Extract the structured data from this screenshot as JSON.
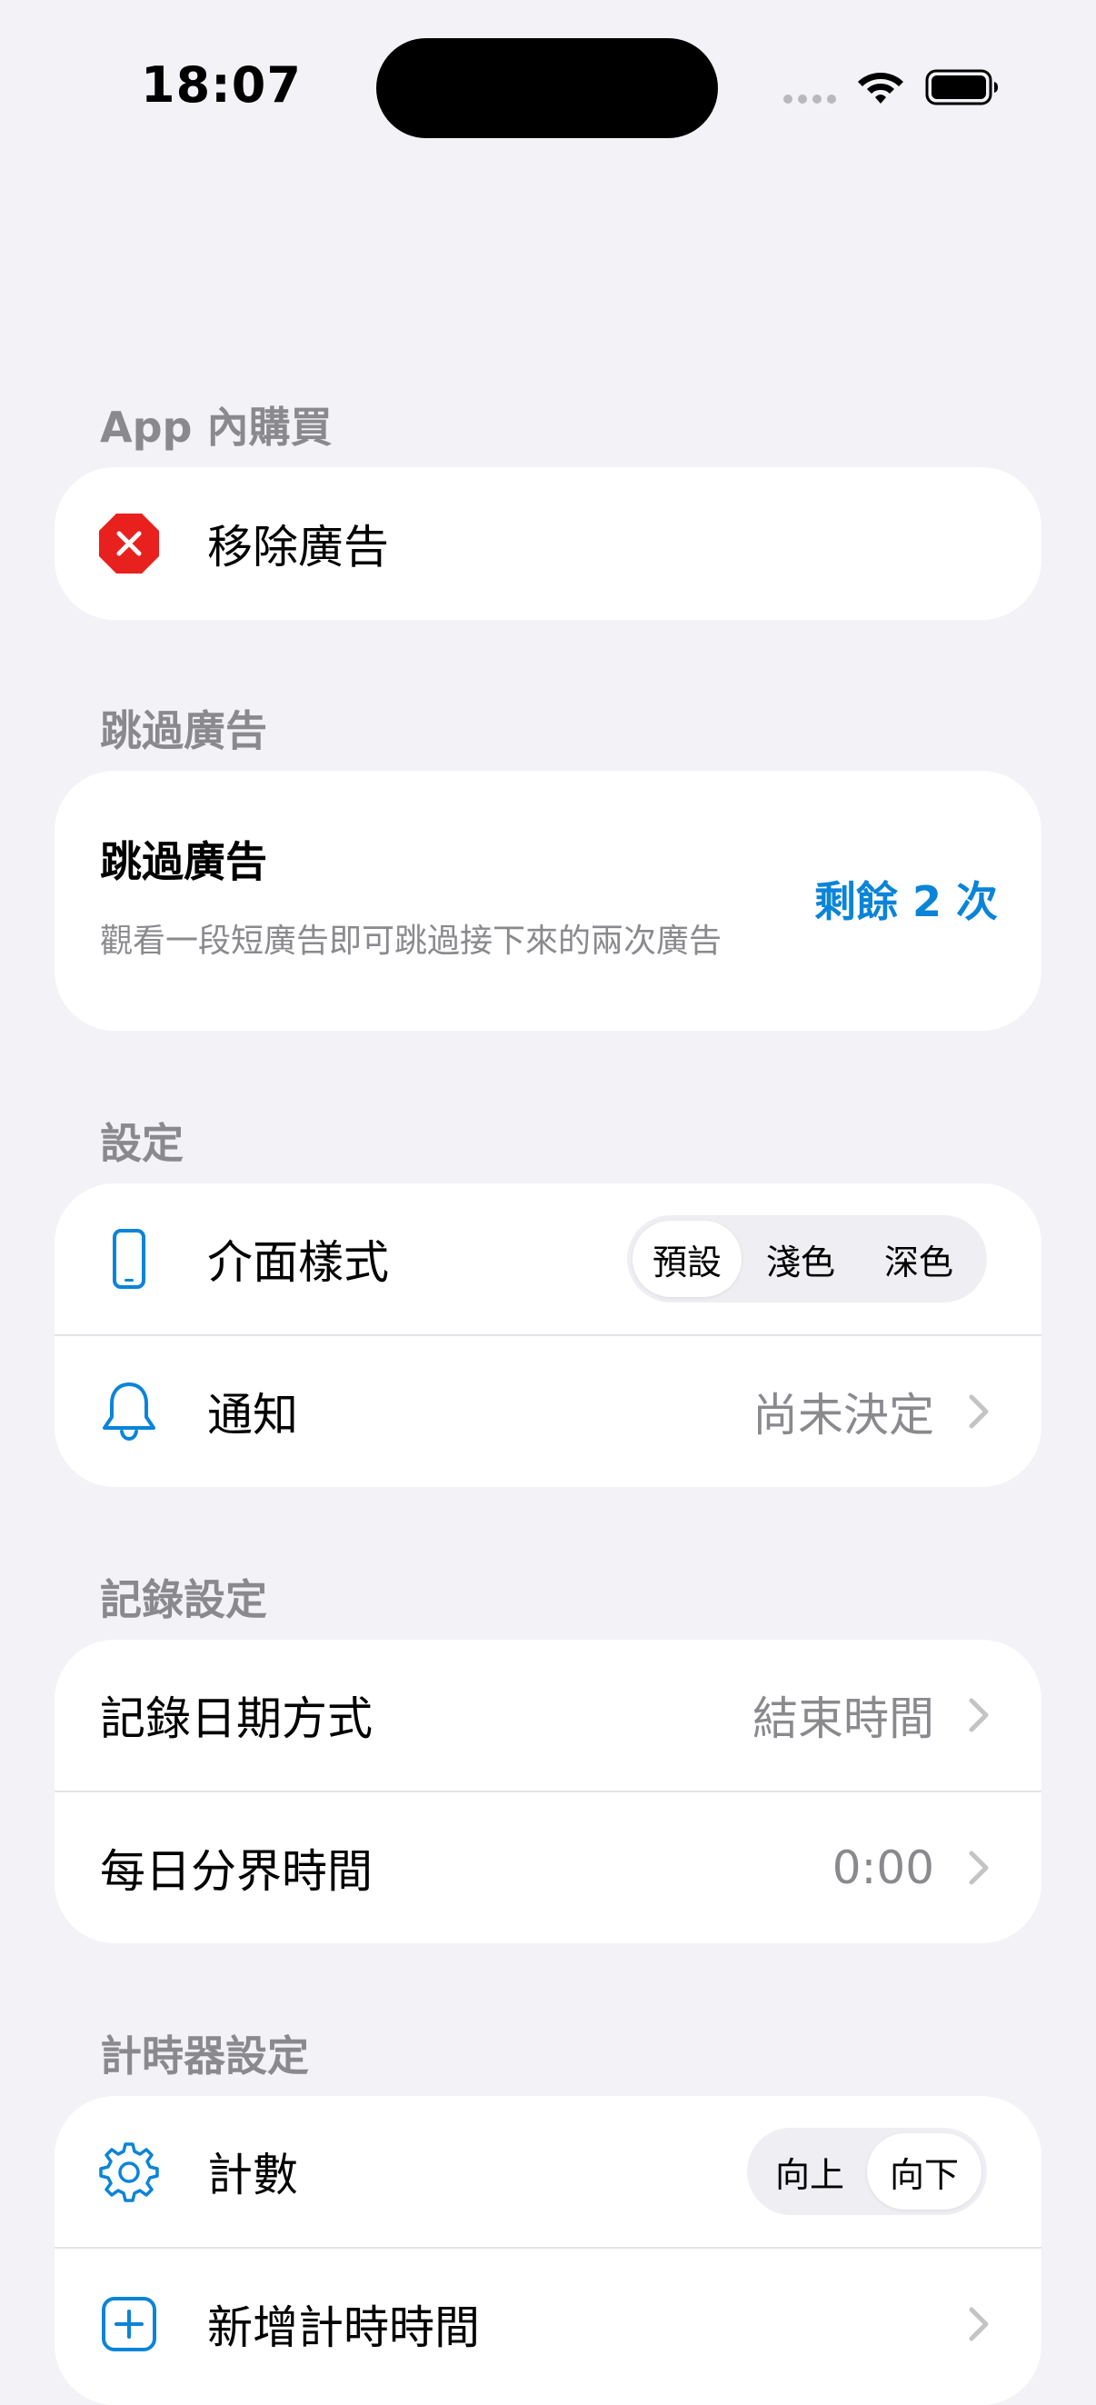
{
  "status_bar": {
    "time": "18:07",
    "icons": [
      "signal-dots-icon",
      "wifi-icon",
      "battery-icon"
    ]
  },
  "sections": {
    "iap": {
      "header": "App 內購買",
      "remove_ads": {
        "label": "移除廣告",
        "icon": "remove-ads-icon",
        "icon_color": "#e8211f"
      }
    },
    "skip_ads": {
      "header": "跳過廣告",
      "title": "跳過廣告",
      "description": "觀看一段短廣告即可跳過接下來的兩次廣告",
      "remaining": "剩餘 2 次",
      "accent": "#0a84d8"
    },
    "settings": {
      "header": "設定",
      "appearance": {
        "label": "介面樣式",
        "icon": "phone-icon",
        "options": [
          "預設",
          "淺色",
          "深色"
        ],
        "selected": "預設"
      },
      "notifications": {
        "label": "通知",
        "icon": "bell-icon",
        "value": "尚未決定"
      }
    },
    "record_settings": {
      "header": "記錄設定",
      "date_mode": {
        "label": "記錄日期方式",
        "value": "結束時間"
      },
      "day_boundary": {
        "label": "每日分界時間",
        "value": "0:00"
      }
    },
    "timer_settings": {
      "header": "計時器設定",
      "count": {
        "label": "計數",
        "icon": "gear-icon",
        "options": [
          "向上",
          "向下"
        ],
        "selected": "向下"
      },
      "add_time": {
        "label": "新增計時時間",
        "icon": "plus-square-icon"
      }
    }
  },
  "colors": {
    "background": "#f2f2f7",
    "card": "#ffffff",
    "accent_blue": "#0a84d8",
    "secondary_text": "#8a8a8e",
    "destructive_red": "#e8211f"
  }
}
